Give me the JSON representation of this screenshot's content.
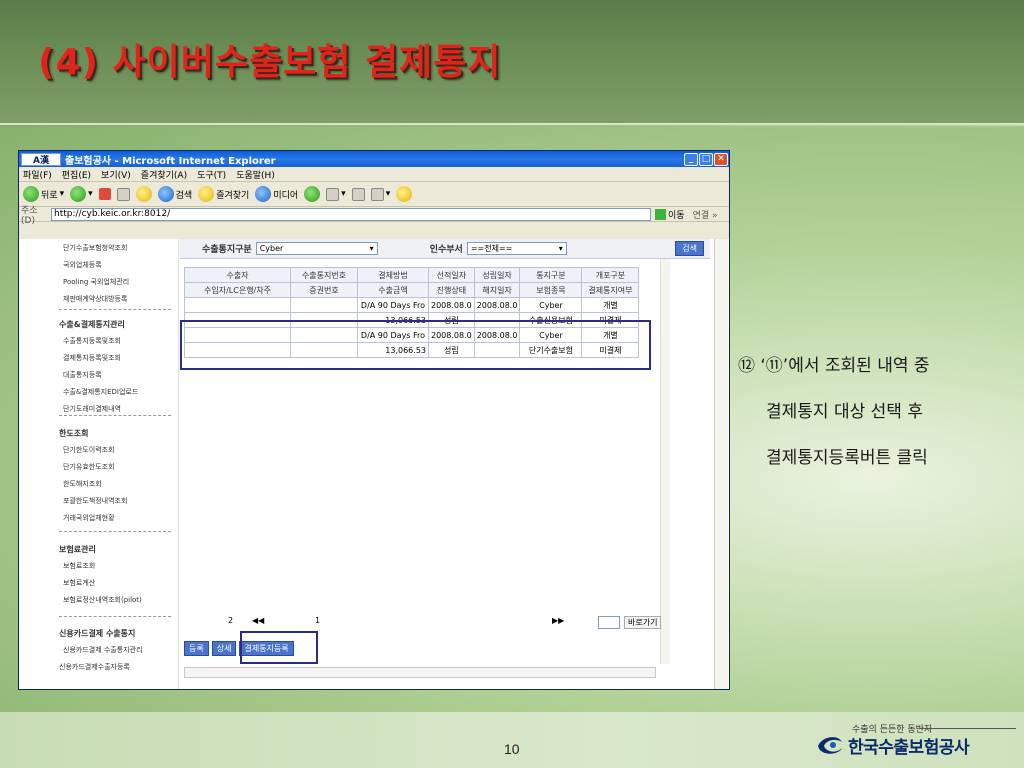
{
  "slide": {
    "title": "(4) 사이버수출보험 결제통지",
    "page_number": "10"
  },
  "note": {
    "line1": "⑫ ‘⑪’에서 조회된 내역 중",
    "line2": "결제통지 대상 선택 후",
    "line3": "결제통지등록버튼 클릭"
  },
  "logo": {
    "tagline": "수출의 든든한 동반자",
    "name": "한국수출보험공사"
  },
  "browser": {
    "app_icon": "A漢",
    "title": "출보험공사 - Microsoft Internet Explorer",
    "menu": [
      "파일(F)",
      "편집(E)",
      "보기(V)",
      "즐겨찾기(A)",
      "도구(T)",
      "도움말(H)"
    ],
    "toolbar": {
      "back": "뒤로",
      "search": "검색",
      "favorites": "즐겨찾기",
      "media": "미디어"
    },
    "address_label": "주소(D)",
    "address": "http://cyb.keic.or.kr:8012/",
    "go": "이동",
    "links": "연결 »"
  },
  "left_menu": {
    "group1": [
      "단기수출보험청약조회",
      "국외업체등록",
      "Pooling 국외업체관리",
      "재판매계약상대방등록"
    ],
    "group2_title": "수출&결제통지관리",
    "group2": [
      "수출통지등록및조회",
      "결제통지등록및조회",
      "대출통지등록",
      "수출&결제통지EDI업로드",
      "단기도래미결제내역"
    ],
    "group3_title": "한도조회",
    "group3": [
      "단기한도이력조회",
      "단기유효한도조회",
      "한도해지조회",
      "포괄한도책정내역조회",
      "거래국외업체현황"
    ],
    "group4_title": "보험료관리",
    "group4": [
      "보험료조회",
      "보험료계산",
      "보험료정산내역조회(pilot)"
    ],
    "group5_title": "신용카드결제 수출통지",
    "group5": [
      "신용카드결제 수출통지관리",
      "신용카드결제수출자등록"
    ]
  },
  "filter": {
    "type_label": "수출통지구분",
    "type_value": "Cyber",
    "dept_label": "인수부서",
    "dept_value": "==전체==",
    "search_button": "검색"
  },
  "grid": {
    "header1": [
      "수출자",
      "수출통지번호",
      "결제방법",
      "선적일자",
      "성립일자",
      "통지구분",
      "개포구분"
    ],
    "header2": [
      "수입자/LC은행/차주",
      "증권번호",
      "수출금액",
      "진행상태",
      "해지일자",
      "보험종목",
      "결제통지여부"
    ],
    "rows": [
      [
        "",
        "",
        "D/A 90 Days Fro",
        "2008.08.0",
        "2008.08.0",
        "Cyber",
        "개별"
      ],
      [
        "",
        "",
        "13,066.53",
        "성립",
        "",
        "수출신용보험",
        "미결제"
      ],
      [
        "",
        "",
        "D/A 90 Days Fro",
        "2008.08.0",
        "2008.08.0",
        "Cyber",
        "개별"
      ],
      [
        "",
        "",
        "13,066.53",
        "성립",
        "",
        "단기수출보험",
        "미결제"
      ]
    ]
  },
  "pager": {
    "total": "2",
    "prev": "◀◀",
    "current": "1",
    "next": "▶▶",
    "goto": "바로가기"
  },
  "actions": {
    "register": "등록",
    "detail": "상세",
    "payment_notice": "결제통지등록"
  }
}
